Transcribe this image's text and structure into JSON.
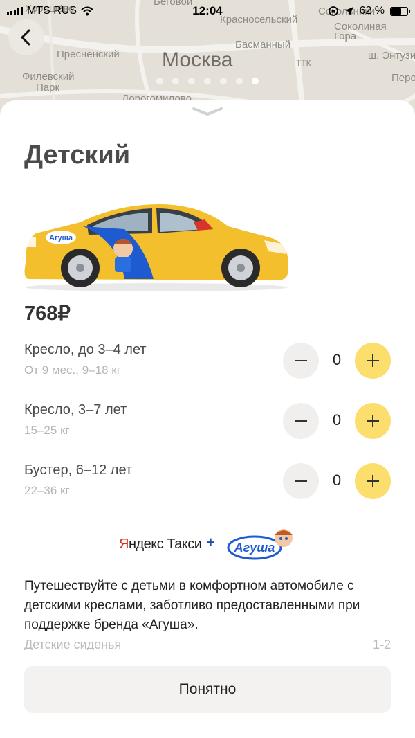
{
  "status_bar": {
    "carrier": "MTS RUS",
    "time": "12:04",
    "battery": "62 %",
    "battery_level": 0.62
  },
  "map": {
    "city": "Москва",
    "labels": [
      "Хорошёво",
      "Беговой",
      "Красносельский",
      "Сокольники",
      "Соколиная",
      "Гора",
      "Пресненский",
      "Филёвский",
      "Парк",
      "Басманный",
      "Дорогомилово",
      "ТТК",
      "ш. Энтузи",
      "Перо"
    ]
  },
  "pager": {
    "count": 7,
    "active_index": 6
  },
  "sheet": {
    "title": "Детский",
    "price": "768₽",
    "seats": [
      {
        "name": "Кресло, до 3–4 лет",
        "sub": "От 9 мес., 9–18 кг",
        "count": "0"
      },
      {
        "name": "Кресло, 3–7 лет",
        "sub": "15–25 кг",
        "count": "0"
      },
      {
        "name": "Бустер, 6–12 лет",
        "sub": "22–36 кг",
        "count": "0"
      }
    ],
    "brand": {
      "yandex_first": "Я",
      "yandex_rest": "ндекс",
      "taxi": "Такси",
      "plus": "+",
      "partner_logo": "Агуша"
    },
    "description": "Путешествуйте с детьми в комфортном автомобиле с детскими креслами, заботливо предоставленными при поддержке бренда «Агуша».",
    "table_row": {
      "label": "Детские сиденья",
      "value": "1-2"
    },
    "ok_button": "Понятно"
  },
  "colors": {
    "accent_yellow": "#fbde6b",
    "car_yellow": "#f3bf2c",
    "yandex_red": "#e4271b"
  }
}
